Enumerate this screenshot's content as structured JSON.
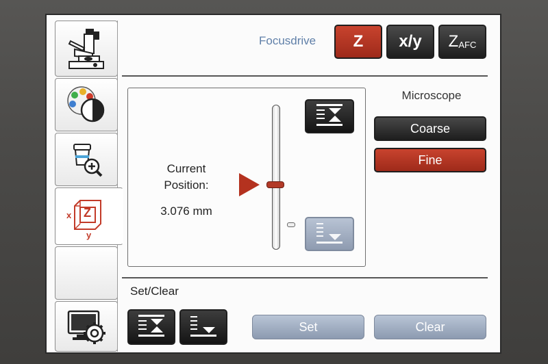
{
  "header": {
    "title": "Focusdrive",
    "buttons": [
      {
        "label": "Z",
        "state": "active"
      },
      {
        "label": "x/y",
        "state": "inactive"
      },
      {
        "label": "Z",
        "sub": "AFC",
        "state": "inactive"
      }
    ]
  },
  "sidebar": {
    "tabs": [
      {
        "icon": "microscope-icon"
      },
      {
        "icon": "contrast-palette-icon"
      },
      {
        "icon": "objective-zoom-icon"
      },
      {
        "icon": "xyz-axis-icon",
        "labels": {
          "x": "x",
          "z": "Z",
          "y": "y"
        },
        "active": true
      },
      {
        "icon": "blank"
      },
      {
        "icon": "monitor-settings-icon"
      }
    ]
  },
  "position": {
    "label_line1": "Current",
    "label_line2": "Position:",
    "value": "3.076 mm"
  },
  "microscope": {
    "title": "Microscope",
    "coarse_label": "Coarse",
    "fine_label": "Fine",
    "selected": "Fine"
  },
  "set_clear": {
    "title": "Set/Clear",
    "set_label": "Set",
    "clear_label": "Clear"
  },
  "colors": {
    "accent_red": "#b4321f",
    "title_blue": "#5f7fa8",
    "disabled_blue": "#9aa7bb"
  }
}
